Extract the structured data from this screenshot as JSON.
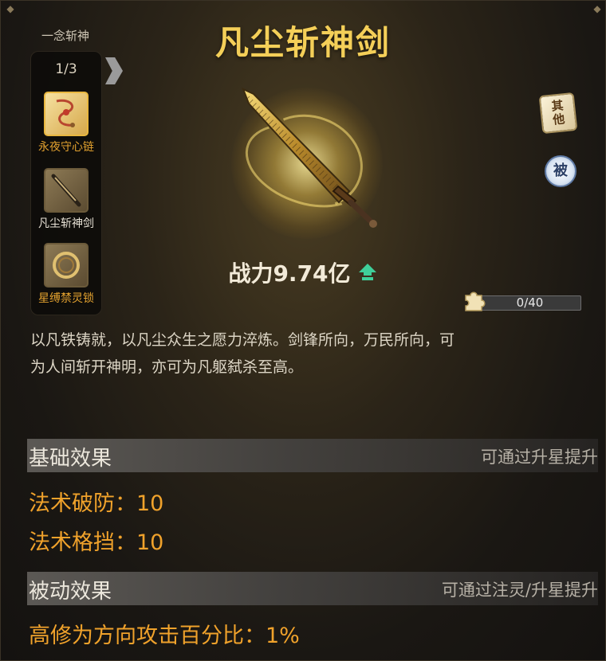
{
  "set": {
    "title": "一念斩神",
    "count": "1/3",
    "items": [
      {
        "label": "永夜守心链",
        "state": "owned",
        "icon": "necklace-icon"
      },
      {
        "label": "凡尘斩神剑",
        "state": "current",
        "icon": "sword-icon"
      },
      {
        "label": "星缚禁灵锁",
        "state": "owned",
        "icon": "ring-icon"
      }
    ]
  },
  "item": {
    "title": "凡尘斩神剑",
    "power_label": "战力9.74亿",
    "power_trend": "up",
    "badges": {
      "other": [
        "其",
        "他"
      ],
      "passive": "被"
    }
  },
  "fragments": {
    "text": "0/40",
    "current": 0,
    "total": 40
  },
  "description": [
    "以凡铁铸就，以凡尘众生之愿力淬炼。剑锋所向，万民所向，可",
    "为人间斩开神明，亦可为凡躯弑杀至高。"
  ],
  "base_effect": {
    "title": "基础效果",
    "hint": "可通过升星提升",
    "stats": [
      "法术破防：10",
      "法术格挡：10"
    ]
  },
  "passive_effect": {
    "title": "被动效果",
    "hint": "可通过注灵/升星提升",
    "stats": [
      "高修为方向攻击百分比：1%"
    ]
  },
  "colors": {
    "title_gold": "#f4cf58",
    "stat_orange": "#f0a22b",
    "label_gold": "#e2a12f",
    "up_green": "#3fcf9a"
  }
}
